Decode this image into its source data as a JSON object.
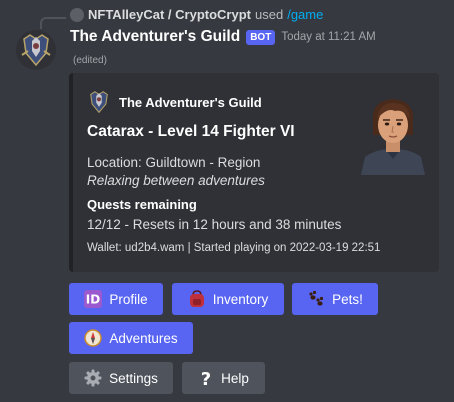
{
  "reply": {
    "user": "NFTAlleyCat / CryptoCrypt",
    "action": "used",
    "command": "/game"
  },
  "message": {
    "author": "The Adventurer's Guild",
    "bot_tag": "BOT",
    "timestamp": "Today at 11:21 AM",
    "edited": "(edited)"
  },
  "embed": {
    "author": "The Adventurer's Guild",
    "title": "Catarax - Level 14 Fighter VI",
    "location": "Location: Guildtown - Region",
    "status": "Relaxing between adventures",
    "field_name": "Quests remaining",
    "field_value": "12/12 - Resets in 12 hours and 38 minutes",
    "footer": "Wallet: ud2b4.wam | Started playing on 2022-03-19 22:51"
  },
  "buttons": {
    "profile": "Profile",
    "inventory": "Inventory",
    "pets": "Pets!",
    "adventures": "Adventures",
    "settings": "Settings",
    "help": "Help"
  },
  "colors": {
    "background": "#36393f",
    "embed_bg": "#2f3136",
    "primary_button": "#5865f2",
    "secondary_button": "#4f545c",
    "command_link": "#00aff4"
  }
}
